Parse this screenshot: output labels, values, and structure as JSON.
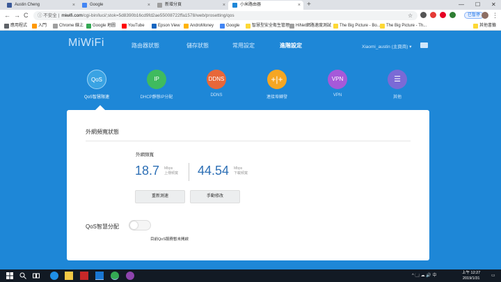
{
  "browser": {
    "tabs": [
      {
        "title": "Austin Cheng",
        "color": "#3b5998"
      },
      {
        "title": "Google",
        "color": "#4285f4"
      },
      {
        "title": "新增分頁",
        "color": "#9e9e9e"
      },
      {
        "title": "小米路由器",
        "color": "#1e87d7"
      }
    ],
    "close_glyph": "×",
    "new_tab_glyph": "+",
    "window_controls": [
      "—",
      "☐",
      "✕"
    ],
    "nav": [
      "←",
      "→",
      "C"
    ],
    "insecure_label": "ⓘ 不安全 |",
    "url_host": "miwifi.com",
    "url_path": "/cgi-bin/luci/;stok=5d8390b16cd9fd2ae55008722ffa1578/web/prosetting/qos",
    "star_glyph": "☆",
    "paused_label": "已暫停",
    "menu_glyph": "⋮",
    "bookmarks": [
      {
        "label": "應用程式",
        "color": "#5f6368"
      },
      {
        "label": "入門",
        "color": "#ff9800"
      },
      {
        "label": "Chrome 線上",
        "color": "#9e9e9e"
      },
      {
        "label": "Google 地圖",
        "color": "#34a853"
      },
      {
        "label": "YouTube",
        "color": "#ff0000"
      },
      {
        "label": "Epson View",
        "color": "#1565c0"
      },
      {
        "label": "AndroMoney",
        "color": "#ffb300"
      },
      {
        "label": "Google",
        "color": "#4285f4"
      },
      {
        "label": "智慧型安全衛生管理...",
        "color": "#fdd835"
      },
      {
        "label": "HiNet網路速度測試",
        "color": "#9e9e9e"
      },
      {
        "label": "The Big Picture - Bo...",
        "color": "#fdd835"
      },
      {
        "label": "The Big Picture - Th...",
        "color": "#fdd835"
      },
      {
        "label": "其他書籤",
        "color": "#fdd835"
      }
    ]
  },
  "router": {
    "logo": "MiWiFi",
    "nav": [
      "路由器狀態",
      "儲存狀態",
      "常用設定",
      "進階設定"
    ],
    "active_nav": "進階設定",
    "user": "Xiaomi_austin (主頁商) ▾",
    "features": [
      {
        "icon_text": "QoS",
        "label": "QoS智慧限速",
        "color": "#3aa3e3"
      },
      {
        "icon_text": "IP",
        "label": "DHCP靜態IP分配",
        "color": "#3fbb5e"
      },
      {
        "icon_text": "DDNS",
        "label": "DDNS",
        "color": "#e7673a"
      },
      {
        "icon_text": "+|+",
        "label": "連接埠轉發",
        "color": "#f5a623"
      },
      {
        "icon_text": "VPN",
        "label": "VPN",
        "color": "#a659d9"
      },
      {
        "icon_text": "☰",
        "label": "其他",
        "color": "#7b6ad6"
      }
    ],
    "active_feature": "QoS智慧限速"
  },
  "card": {
    "section_title": "外網頻寬狀態",
    "bandwidth_label": "外網頻寬",
    "upload": {
      "value": "18.7",
      "unit": "Mbps",
      "caption": "上傳頻寬"
    },
    "download": {
      "value": "44.54",
      "unit": "Mbps",
      "caption": "下載頻寬"
    },
    "buttons": {
      "retest": "重新測速",
      "manual": "手動修改"
    },
    "qos_label": "QoS智慧分配",
    "qos_enabled": false,
    "qos_status": "目前QoS服務暫未開啟"
  },
  "taskbar": {
    "apps": [
      {
        "name": "windows-icon",
        "color": "#ffffff"
      },
      {
        "name": "search-icon",
        "color": "#ffffff"
      },
      {
        "name": "task-view-icon",
        "color": "#ffffff"
      },
      {
        "name": "edge-icon",
        "color": "#1f8fe6"
      },
      {
        "name": "explorer-icon",
        "color": "#f3c845"
      },
      {
        "name": "app-red-icon",
        "color": "#c62828"
      },
      {
        "name": "app-blue-icon",
        "color": "#1976d2"
      },
      {
        "name": "chrome-icon",
        "color": "#34a853"
      },
      {
        "name": "app-purple-icon",
        "color": "#8e44ad"
      }
    ],
    "tray": "^ 🗔 ☁ 🔊 中",
    "time": "上午 12:27",
    "date": "2019/1/31"
  }
}
